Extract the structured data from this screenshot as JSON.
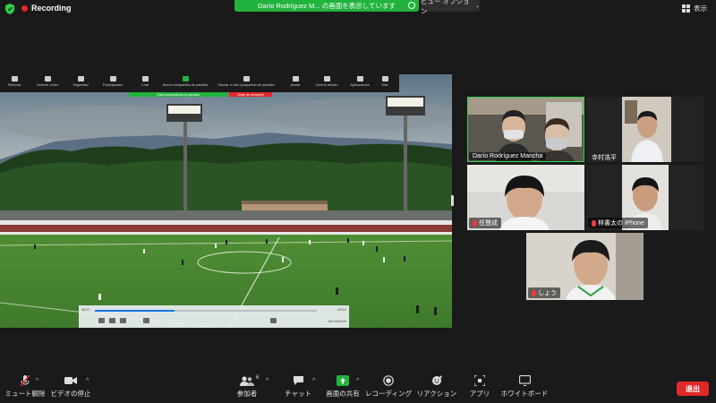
{
  "top_bar": {
    "recording_label": "Recording",
    "share_banner_text": "Darío Rodríguez M... の画面を表示しています",
    "view_options_label": "ビュー オプション",
    "display_label": "表示"
  },
  "shared_screen": {
    "toolbar_items": [
      "Silenciar",
      "Detener vídeo",
      "Seguridad",
      "Participantes",
      "Chat",
      "Nuevo compartido de pantalla",
      "Pausar el uso compartido de pantalla",
      "Anotar",
      "Control remoto",
      "Aplicaciones",
      "Más"
    ],
    "share_banner_left": "Está compartiendo la pantalla",
    "share_banner_right": "Dejar de compartir",
    "player_time_left": "00:07",
    "player_time_right": "-00:12",
    "player_time_bottom": "-00:12/00:20",
    "player_progress": 0.36,
    "banner_color_green": "#21b33d",
    "banner_color_red": "#e02828"
  },
  "participants": [
    {
      "name": "Darío Rodríguez Mancha",
      "active": true,
      "muted": false
    },
    {
      "name": "寺村浩平",
      "active": false,
      "muted": false
    },
    {
      "name": "任慧成",
      "active": false,
      "muted": true
    },
    {
      "name": "林書太の iPhone",
      "active": false,
      "muted": true
    },
    {
      "name": "しょう",
      "active": false,
      "muted": true
    }
  ],
  "bottom_toolbar": {
    "mute_label": "ミュート解除",
    "video_label": "ビデオの停止",
    "participants_label": "参加者",
    "participants_count": "6",
    "chat_label": "チャット",
    "share_label": "画面の共有",
    "record_label": "レコーディング",
    "reaction_label": "リアクション",
    "apps_label": "アプリ",
    "whiteboard_label": "ホワイトボード",
    "leave_label": "退出"
  },
  "colors": {
    "accent_green": "#21b33d",
    "leave_red": "#e02828",
    "active_speaker_border": "#2fd24b"
  }
}
